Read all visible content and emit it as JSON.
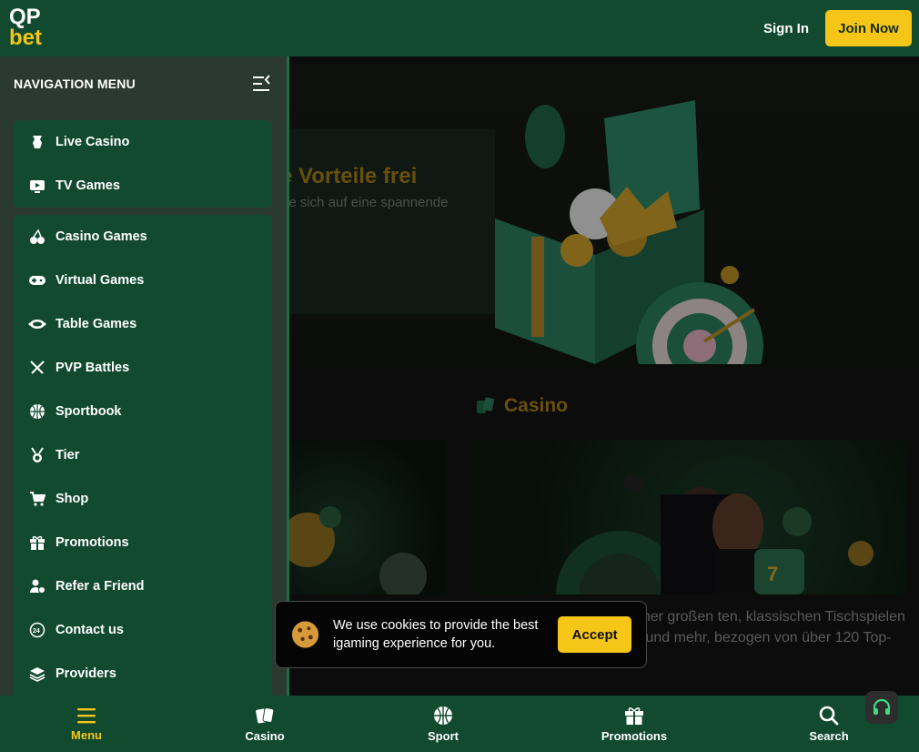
{
  "header": {
    "logo_line1": "QP",
    "logo_line2": "bet",
    "sign_in": "Sign In",
    "join_now": "Join Now"
  },
  "background": {
    "promo_title": "e Vorteile frei",
    "promo_subtitle": "ie sich auf eine spannende",
    "section_title": "Casino",
    "description": "ltiges Online-Casino mit einer großen ten, klassischen Tischspielen wie spannendem Roulette und mehr, bezogen von über 120 Top-Anbietern, um Fairness zu"
  },
  "sidenav": {
    "title": "NAVIGATION MENU",
    "group1": [
      {
        "label": "Live Casino",
        "icon": "live-casino-icon"
      },
      {
        "label": "TV Games",
        "icon": "tv-icon"
      }
    ],
    "group2": [
      {
        "label": "Casino Games",
        "icon": "cherry-icon"
      },
      {
        "label": "Virtual Games",
        "icon": "gamepad-icon"
      },
      {
        "label": "Table Games",
        "icon": "table-icon"
      },
      {
        "label": "PVP Battles",
        "icon": "swords-icon"
      },
      {
        "label": "Sportbook",
        "icon": "basketball-icon"
      },
      {
        "label": "Tier",
        "icon": "medal-icon"
      },
      {
        "label": "Shop",
        "icon": "cart-icon"
      },
      {
        "label": "Promotions",
        "icon": "gift-icon"
      },
      {
        "label": "Refer a Friend",
        "icon": "refer-icon"
      },
      {
        "label": "Contact us",
        "icon": "24h-icon"
      },
      {
        "label": "Providers",
        "icon": "layers-icon"
      }
    ]
  },
  "cookie": {
    "text": "We use cookies to provide the best igaming experience for you.",
    "accept": "Accept"
  },
  "bottom_nav": [
    {
      "label": "Menu",
      "icon": "menu-icon",
      "active": true
    },
    {
      "label": "Casino",
      "icon": "cards-icon",
      "active": false
    },
    {
      "label": "Sport",
      "icon": "basketball-icon",
      "active": false
    },
    {
      "label": "Promotions",
      "icon": "gift-icon",
      "active": false
    },
    {
      "label": "Search",
      "icon": "search-icon",
      "active": false
    }
  ],
  "colors": {
    "brand_green": "#124a2f",
    "accent_yellow": "#f5c518"
  }
}
